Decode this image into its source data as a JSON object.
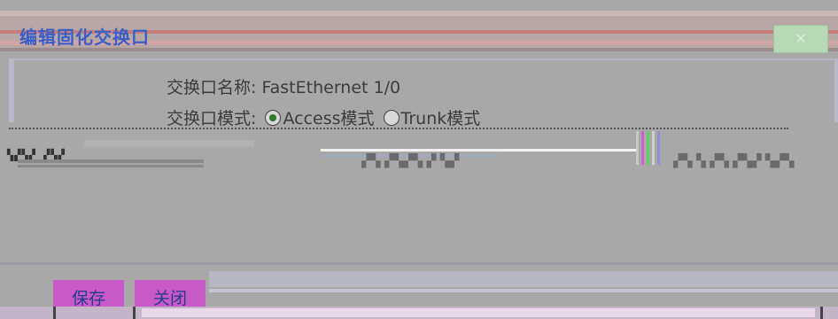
{
  "dialog": {
    "title": "编辑固化交换口",
    "close_icon": "close-icon"
  },
  "form": {
    "port_name_label": "交换口名称:",
    "port_name_value": "FastEthernet 1/0",
    "mode_label": "交换口模式:",
    "mode_options": [
      {
        "label": "Access模式",
        "selected": true
      },
      {
        "label": "Trunk模式",
        "selected": false
      }
    ]
  },
  "buttons": {
    "save": "保存",
    "close": "关闭"
  },
  "colors": {
    "title": "#3a5fc8",
    "button_bg": "#c85ac8",
    "button_text": "#2b3a8e",
    "close_button_bg": "#b8d8b8"
  }
}
